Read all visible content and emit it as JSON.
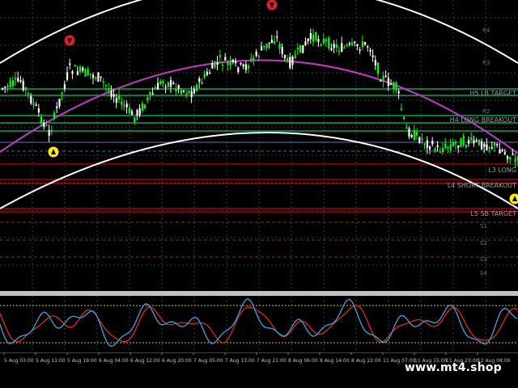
{
  "colors": {
    "background": "#000000",
    "grid": "#2a4a2a",
    "candle_up": "#00ff00",
    "candle_down": "#ffffff",
    "curve_outer": "#ffffff",
    "curve_mid": "#cc33cc",
    "level_green": "#00cc66",
    "level_red": "#cc0000",
    "level_label": "#9a9a9a",
    "osc_signal": "#ff2020",
    "osc_main": "#30a0d0",
    "osc_level": "#cccc00",
    "sell_marker": "#e02020",
    "buy_marker": "#ffee00"
  },
  "markers": [
    {
      "type": "sell",
      "icon": "down-arrow-icon"
    },
    {
      "type": "buy",
      "icon": "up-arrow-icon"
    },
    {
      "type": "sell",
      "icon": "down-arrow-icon"
    },
    {
      "type": "buy",
      "icon": "up-arrow-icon"
    }
  ],
  "levels": [
    {
      "label": "H5 LB TARGET",
      "color": "green"
    },
    {
      "label": "H4 LONG BREAKOUT",
      "color": "green"
    },
    {
      "label": "L3 LONG",
      "color": "red"
    },
    {
      "label": "L4 SHORT BREAKOUT",
      "color": "red"
    },
    {
      "label": "L5 SB TARGET",
      "color": "red"
    }
  ],
  "pivot_labels": [
    "R4",
    "R3",
    "R2",
    "S1",
    "S2",
    "S3",
    "S4"
  ],
  "time_labels": [
    "5 Aug 03:00",
    "5 Aug 11:00",
    "5 Aug 19:00",
    "6 Aug 04:00",
    "6 Aug 12:00",
    "6 Aug 20:00",
    "7 Aug 05:00",
    "7 Aug 13:00",
    "7 Aug 21:00",
    "8 Aug 06:00",
    "8 Aug 14:00",
    "8 Aug 22:00",
    "11 Aug 07:00",
    "11 Aug 15:00",
    "11 Aug 23:00",
    "12 Aug 08:00"
  ],
  "watermark": "www.mt4.shop"
}
